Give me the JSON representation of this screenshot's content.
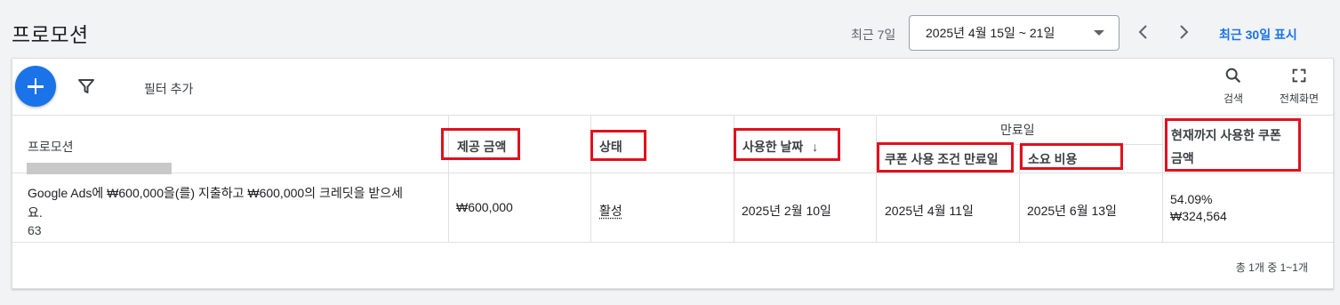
{
  "page": {
    "title": "프로모션"
  },
  "date_range": {
    "label": "최근 7일",
    "value": "2025년 4월 15일 ~ 21일",
    "show_30_days": "최근 30일 표시"
  },
  "toolbar": {
    "filter_add": "필터 추가",
    "search_label": "검색",
    "fullscreen_label": "전체화면"
  },
  "table": {
    "headers": {
      "promotion": "프로모션",
      "offer_amount": "제공 금액",
      "status": "상태",
      "used_date": "사용한 날짜",
      "expiry_group": "만료일",
      "coupon_expiry": "쿠폰 사용 조건 만료일",
      "cost_expiry": "소요 비용",
      "used_amount_line1": "현재까지 사용한 쿠폰",
      "used_amount_line2": "금액"
    },
    "sort_indicator": "↓",
    "rows": [
      {
        "promotion_line1": "Google Ads에 ₩600,000을(를) 지출하고 ₩600,000의 크레딧을 받으세",
        "promotion_line2": "요.",
        "promotion_id_prefix": "63",
        "offer_amount": "₩600,000",
        "status": "활성",
        "used_date": "2025년 2월 10일",
        "coupon_expiry": "2025년 4월 11일",
        "cost_expiry": "2025년 6월 13일",
        "used_percent": "54.09%",
        "used_amount": "₩324,564"
      }
    ],
    "pagination": "총 1개 중 1~1개"
  },
  "colors": {
    "accent": "#1a73e8",
    "highlight_box": "#e0101e"
  }
}
